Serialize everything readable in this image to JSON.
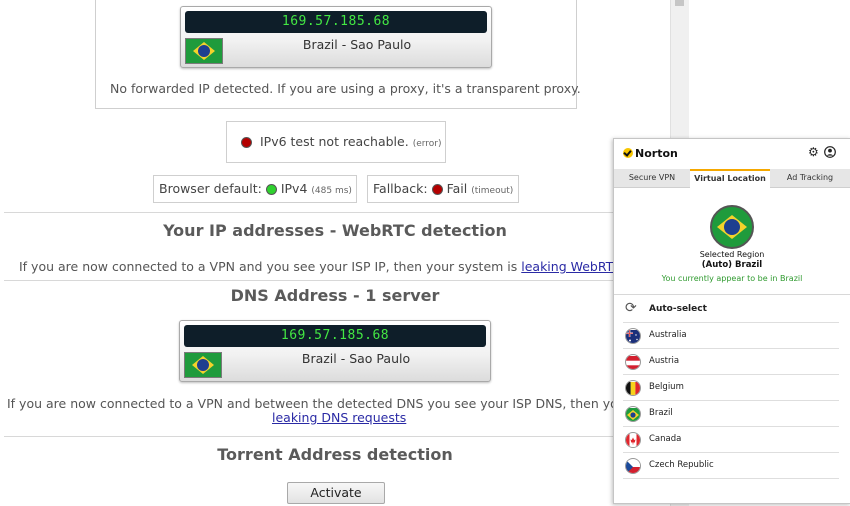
{
  "ip_card_top": {
    "ip": "169.57.185.68",
    "location": "Brazil - Sao Paulo",
    "flag_icon": "brazil-flag-icon"
  },
  "forwarded_note": "No forwarded IP detected. If you are using a proxy, it's a transparent proxy.",
  "ipv6": {
    "text": "IPv6 test not reachable.",
    "note": "(error)"
  },
  "browser_default": {
    "label": "Browser default:",
    "value": "IPv4",
    "note": "(485 ms)"
  },
  "fallback": {
    "label": "Fallback:",
    "value": "Fail",
    "note": "(timeout)"
  },
  "webrtc": {
    "heading": "Your IP addresses - WebRTC detection",
    "text": "If you are now connected to a VPN and you see your ISP IP, then your system is ",
    "link": "leaking WebRTC re"
  },
  "dns": {
    "heading": "DNS Address - 1 server",
    "ip": "169.57.185.68",
    "location": "Brazil - Sao Paulo",
    "text": "If you are now connected to a VPN and between the detected DNS you see your ISP DNS, then your s",
    "link": "leaking DNS requests"
  },
  "torrent": {
    "heading": "Torrent Address detection",
    "button": "Activate"
  },
  "norton": {
    "logo": "Norton",
    "settings_icon": "gear-icon",
    "account_icon": "account-icon",
    "tabs": [
      "Secure VPN",
      "Virtual Location",
      "Ad Tracking"
    ],
    "active_tab": "Virtual Location",
    "selected_region_label": "Selected Region",
    "selected_region": "(Auto) Brazil",
    "status": "You currently appear to be in Brazil",
    "locations": [
      "Auto-select",
      "Australia",
      "Austria",
      "Belgium",
      "Brazil",
      "Canada",
      "Czech Republic"
    ]
  },
  "colors": {
    "ip_display_bg": "#0e1e29",
    "ip_text": "#43e743",
    "link": "#2a2aa5",
    "norton_accent": "#f5a800",
    "status_green": "#2f9a2f"
  }
}
